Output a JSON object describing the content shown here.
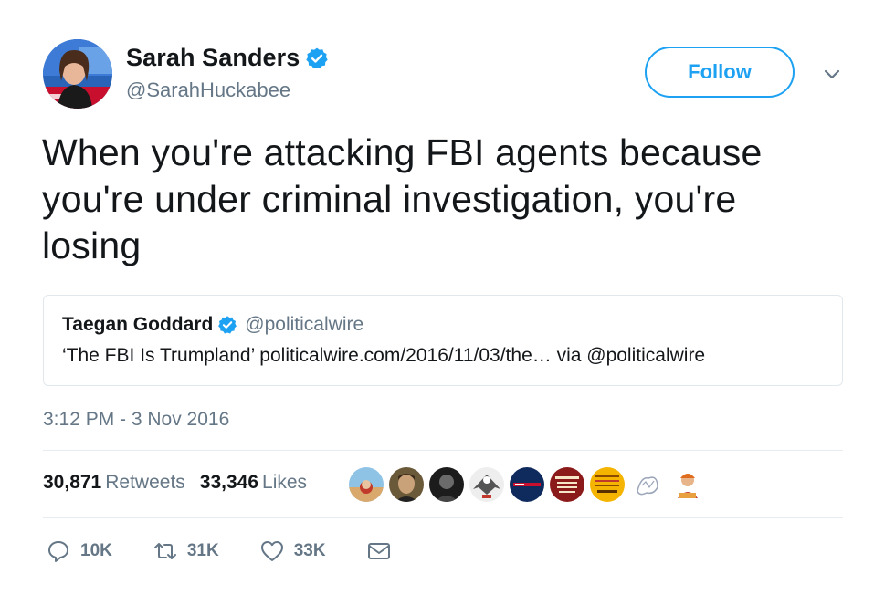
{
  "author": {
    "display_name": "Sarah Sanders",
    "handle": "@SarahHuckabee",
    "verified": true
  },
  "follow_label": "Follow",
  "tweet_lines": [
    "When you're attacking FBI agents because",
    "you're under criminal investigation, you're",
    "losing"
  ],
  "quoted": {
    "display_name": "Taegan Goddard",
    "handle": "@politicalwire",
    "text": "‘The FBI Is Trumpland’ politicalwire.com/2016/11/03/the… via @politicalwire"
  },
  "timestamp": "3:12 PM - 3 Nov 2016",
  "stats": {
    "retweets_count": "30,871",
    "retweets_label": "Retweets",
    "likes_count": "33,346",
    "likes_label": "Likes"
  },
  "actions": {
    "replies": "10K",
    "retweets": "31K",
    "likes": "33K"
  },
  "icons": {
    "verified": "verified-badge-icon",
    "caret": "chevron-down-icon",
    "reply": "reply-icon",
    "retweet": "retweet-icon",
    "like": "heart-icon",
    "message": "envelope-icon"
  },
  "colors": {
    "accent": "#1da1f2",
    "muted": "#657786",
    "text": "#14171a",
    "border": "#e1e8ed"
  }
}
